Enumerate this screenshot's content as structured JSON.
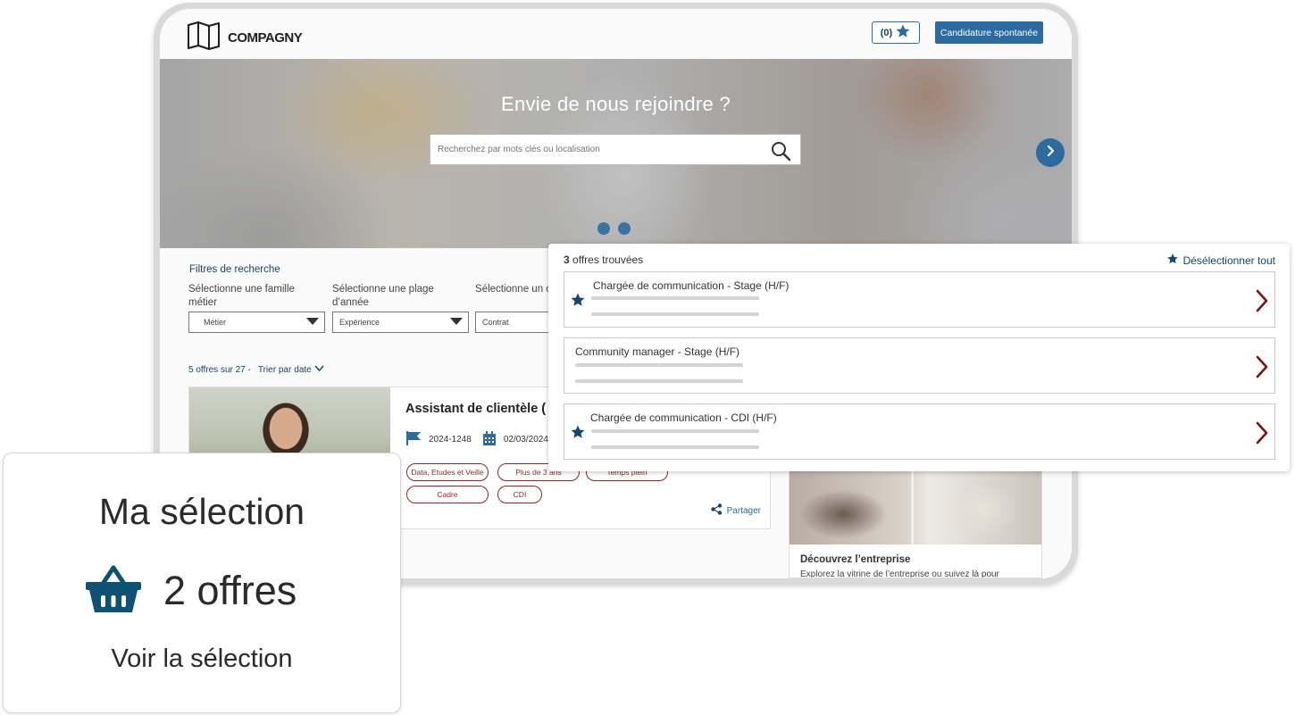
{
  "header": {
    "brand": "COMPAGNY",
    "favorites_label": "(0)",
    "cta_label": "Candidature spontanée"
  },
  "hero": {
    "title": "Envie de nous rejoindre ?",
    "search_placeholder": "Recherchez par mots clés ou localisation"
  },
  "filters": {
    "title": "Filtres de recherche",
    "items": [
      {
        "label": "Sélectionne une famille métier",
        "value": "Métier"
      },
      {
        "label": "Sélectionne une plage d’année",
        "value": "Expérience"
      },
      {
        "label": "Sélectionne un contrat",
        "value": "Contrat"
      }
    ]
  },
  "results_bar": {
    "count": "5 offres sur 27 -",
    "sort_prefix": "Trier par",
    "sort_value": "date"
  },
  "job_card": {
    "title": "Assistant de clientèle (",
    "reference": "2024-1248",
    "date": "02/03/2024",
    "tags": [
      "Data, Etudes et Veille",
      "Plus de 3 ans",
      "Temps plein",
      "Cadre",
      "CDI"
    ],
    "share_label": "Partager"
  },
  "company_card": {
    "title": "Découvrez l’entreprise",
    "description": "Explorez la vitrine de l’entreprise ou suivez là pour"
  },
  "results_popup": {
    "count_number": "3",
    "count_label": "offres trouvées",
    "deselect_label": "Désélectionner tout",
    "offers": [
      {
        "title": "Chargée de communication - Stage (H/F)",
        "starred": true
      },
      {
        "title": "Community manager - Stage (H/F)",
        "starred": false
      },
      {
        "title": "Chargée de communication - CDI (H/F)",
        "starred": true
      }
    ]
  },
  "selection_card": {
    "title": "Ma sélection",
    "count": "2 offres",
    "link": "Voir la sélection"
  },
  "colors": {
    "primary": "#2c6aa0",
    "primary_dark": "#16456e",
    "tag_red": "#8a2a2a",
    "chevron_red": "#7a1414"
  }
}
